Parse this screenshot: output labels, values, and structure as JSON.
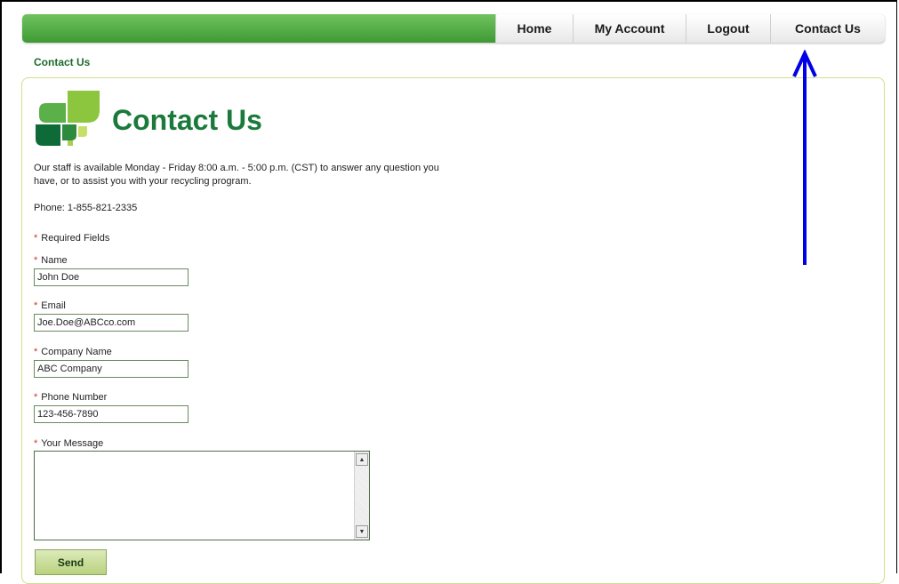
{
  "nav": {
    "home": "Home",
    "my_account": "My Account",
    "logout": "Logout",
    "contact_us": "Contact Us"
  },
  "breadcrumb": "Contact Us",
  "page": {
    "title": "Contact Us",
    "intro": "Our staff is available Monday - Friday 8:00 a.m. - 5:00 p.m. (CST) to answer any question you have, or to assist you with your recycling program.",
    "phone": "Phone: 1-855-821-2335"
  },
  "form": {
    "required_note": "Required Fields",
    "name_label": "Name",
    "name_value": "John Doe",
    "email_label": "Email",
    "email_value": "Joe.Doe@ABCco.com",
    "company_label": "Company Name",
    "company_value": "ABC Company",
    "phone_label": "Phone Number",
    "phone_value": "123-456-7890",
    "message_label": "Your Message",
    "message_value": "",
    "send_label": "Send"
  },
  "colors": {
    "nav_green": "#4aa63d",
    "title_green": "#1b7a3b",
    "required_red": "#d0302c",
    "annotation_arrow": "#0000e6"
  },
  "icons": {
    "logo": "leaf-logo-icon",
    "annotation": "up-arrow-icon"
  }
}
